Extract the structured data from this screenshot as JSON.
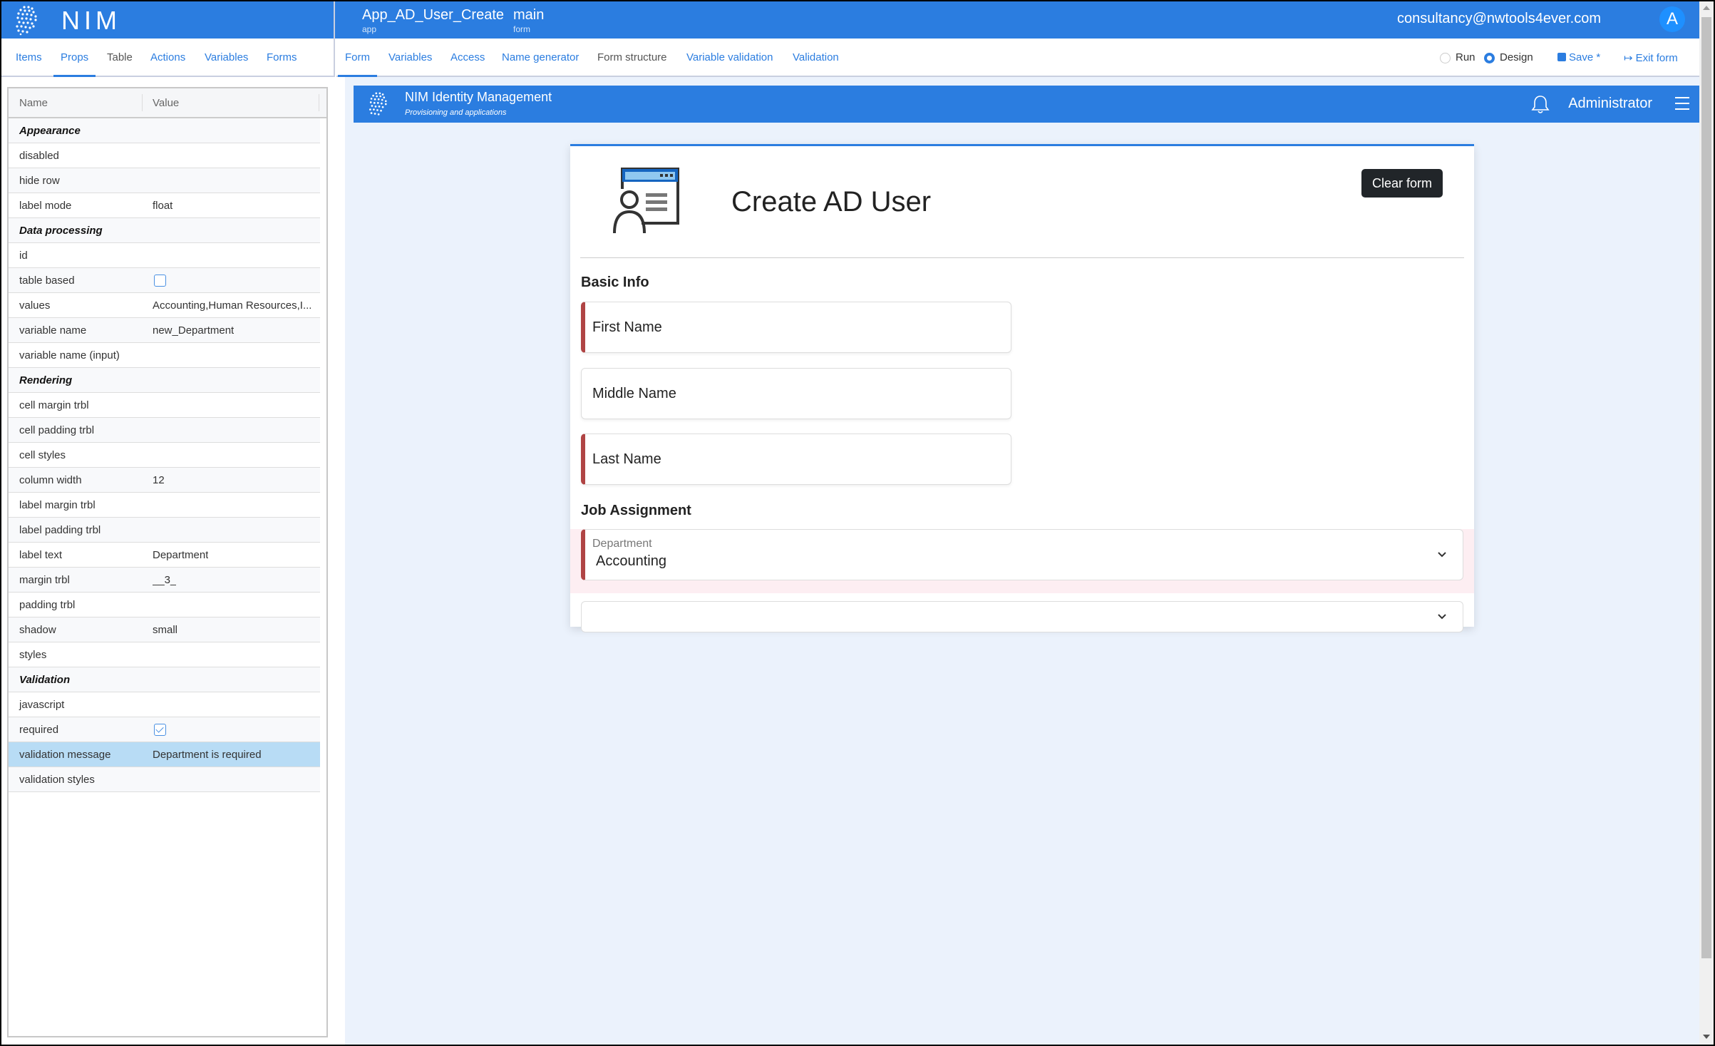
{
  "topbar": {
    "brand": "NIM",
    "app_name": "App_AD_User_Create",
    "app_type": "app",
    "form_name": "main",
    "form_type": "form",
    "user_email": "consultancy@nwtools4ever.com",
    "avatar_letter": "A"
  },
  "left_tabs": [
    {
      "label": "Items",
      "active": false
    },
    {
      "label": "Props",
      "active": true
    },
    {
      "label": "Table",
      "active": false
    },
    {
      "label": "Actions",
      "active": false
    },
    {
      "label": "Variables",
      "active": false
    },
    {
      "label": "Forms",
      "active": false
    }
  ],
  "right_tabs": [
    {
      "label": "Form",
      "active": true
    },
    {
      "label": "Variables",
      "active": false
    },
    {
      "label": "Access",
      "active": false
    },
    {
      "label": "Name generator",
      "active": false
    },
    {
      "label": "Form structure",
      "active": false
    },
    {
      "label": "Variable validation",
      "active": false
    },
    {
      "label": "Validation",
      "active": false
    }
  ],
  "mode": {
    "run_label": "Run",
    "design_label": "Design",
    "selected": "Design"
  },
  "toolbar": {
    "save_label": "Save *",
    "exit_label": "Exit form"
  },
  "props": {
    "col_name": "Name",
    "col_value": "Value",
    "rows": [
      {
        "name": "Appearance",
        "section": true
      },
      {
        "name": "disabled",
        "value": ""
      },
      {
        "name": "hide row",
        "value": ""
      },
      {
        "name": "label mode",
        "value": "float"
      },
      {
        "name": "Data processing",
        "section": true
      },
      {
        "name": "id",
        "value": ""
      },
      {
        "name": "table based",
        "checkbox": true,
        "checked": false
      },
      {
        "name": "values",
        "value": "Accounting,Human Resources,I..."
      },
      {
        "name": "variable name",
        "value": "new_Department"
      },
      {
        "name": "variable name (input)",
        "value": ""
      },
      {
        "name": "Rendering",
        "section": true
      },
      {
        "name": "cell margin trbl",
        "value": ""
      },
      {
        "name": "cell padding trbl",
        "value": ""
      },
      {
        "name": "cell styles",
        "value": ""
      },
      {
        "name": "column width",
        "value": "12"
      },
      {
        "name": "label margin trbl",
        "value": ""
      },
      {
        "name": "label padding trbl",
        "value": ""
      },
      {
        "name": "label text",
        "value": "Department"
      },
      {
        "name": "margin trbl",
        "value": "__3_"
      },
      {
        "name": "padding trbl",
        "value": ""
      },
      {
        "name": "shadow",
        "value": "small"
      },
      {
        "name": "styles",
        "value": ""
      },
      {
        "name": "Validation",
        "section": true
      },
      {
        "name": "javascript",
        "value": ""
      },
      {
        "name": "required",
        "checkbox": true,
        "checked": true
      },
      {
        "name": "validation message",
        "value": "Department is required",
        "selected": true
      },
      {
        "name": "validation styles",
        "value": ""
      }
    ]
  },
  "preview": {
    "header_title": "NIM Identity Management",
    "header_subtitle": "Provisioning and applications",
    "user_label": "Administrator",
    "form_title": "Create AD User",
    "clear_button": "Clear form",
    "section_basic": "Basic Info",
    "fields": [
      {
        "placeholder": "First Name",
        "required": true
      },
      {
        "placeholder": "Middle Name",
        "required": false
      },
      {
        "placeholder": "Last Name",
        "required": true
      }
    ],
    "section_job": "Job Assignment",
    "department": {
      "label": "Department",
      "value": "Accounting",
      "required": true
    },
    "second_select": {
      "value": ""
    }
  },
  "colors": {
    "brand": "#2b7de0",
    "required_marker": "#b04444",
    "selected_row": "#b8dcf5"
  }
}
